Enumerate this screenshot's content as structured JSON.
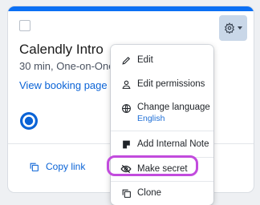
{
  "card": {
    "title": "Calendly Intro",
    "meta": "30 min, One-on-One",
    "view_link": "View booking page",
    "copy_link": "Copy link",
    "accent": "#0a6ff4"
  },
  "menu": {
    "items": [
      {
        "label": "Edit",
        "icon": "pencil-icon"
      },
      {
        "label": "Edit permissions",
        "icon": "person-icon"
      },
      {
        "label": "Change language",
        "sublabel": "English",
        "icon": "globe-icon"
      },
      {
        "label": "Add Internal Note",
        "icon": "note-icon"
      },
      {
        "label": "Make secret",
        "icon": "eye-off-icon"
      },
      {
        "label": "Clone",
        "icon": "clone-icon"
      }
    ],
    "highlight_color": "#c24bdd"
  }
}
